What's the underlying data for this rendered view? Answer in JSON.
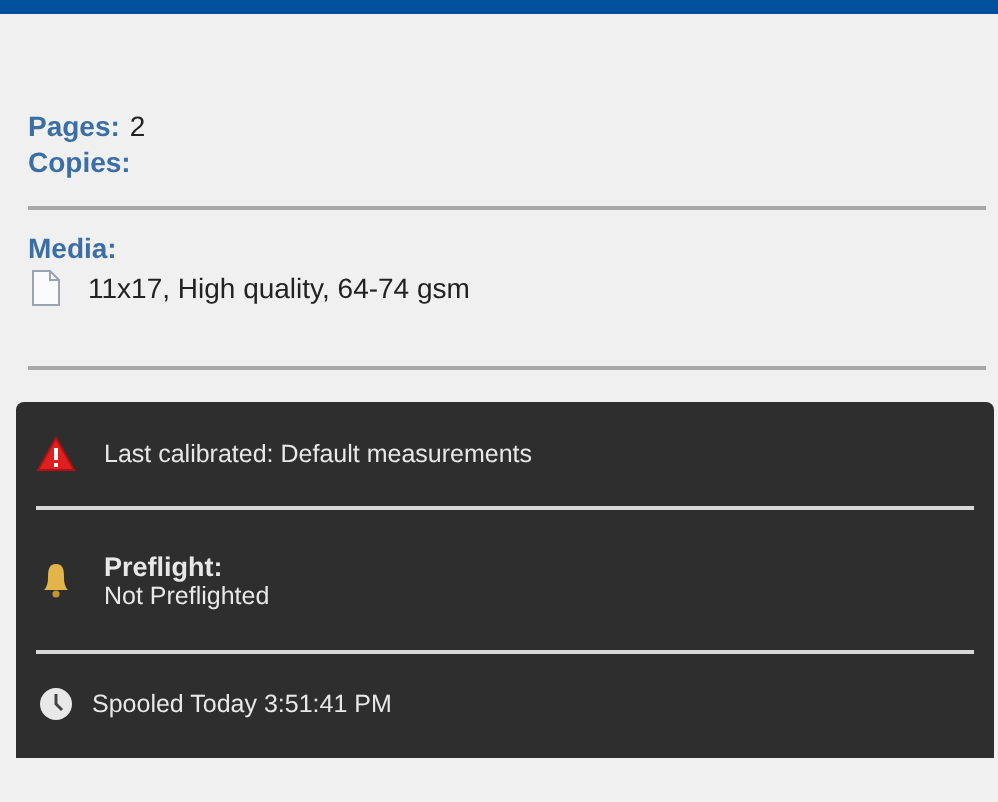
{
  "job_details": {
    "fields": [
      {
        "label": "Pages:",
        "value": "2"
      },
      {
        "label": "Copies:"
      }
    ],
    "media": {
      "label": "Media:",
      "value": "11x17, High quality, 64-74 gsm"
    }
  },
  "status_panel": {
    "items": [
      {
        "kind": "warning",
        "text": "Last calibrated: Default measurements"
      },
      {
        "kind": "bell",
        "title": "Preflight:",
        "text": "Not Preflighted"
      },
      {
        "kind": "clock",
        "text": "Spooled Today 3:51:41 PM"
      }
    ]
  }
}
